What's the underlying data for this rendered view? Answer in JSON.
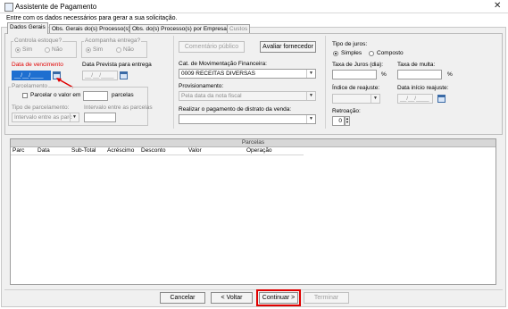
{
  "window": {
    "title": "Assistente de Pagamento",
    "close_glyph": "✕",
    "instruction": "Entre com os dados necessários para gerar a sua solicitação."
  },
  "tabs": [
    {
      "label": "Dados Gerais",
      "active": true,
      "enabled": true
    },
    {
      "label": "Obs. Gerais do(s) Processo(s)",
      "active": false,
      "enabled": true
    },
    {
      "label": "Obs. do(s) Processo(s) por Empresa(s)",
      "active": false,
      "enabled": true
    },
    {
      "label": "Custos",
      "active": false,
      "enabled": false
    }
  ],
  "left": {
    "controla_estoque": {
      "label": "Controla estoque?",
      "sim": "Sim",
      "nao": "Não",
      "selected": "Sim"
    },
    "acompanha_entrega": {
      "label": "Acompanha entrega?",
      "sim": "Sim",
      "nao": "Não",
      "selected": "Sim"
    },
    "data_vencimento": {
      "label": "Data de vencimento",
      "value": "__/__/____"
    },
    "data_prevista": {
      "label": "Data Prevista para entrega",
      "value": "__/__/____"
    },
    "parcelamento": {
      "label": "Parcelamento",
      "parcelar_label": "Parcelar o valor em",
      "parcelas_value": "",
      "parcelas_suffix": "parcelas",
      "tipo_label": "Tipo de parcelamento:",
      "tipo_value": "Intervalo entre as parc",
      "intervalo_label": "Intervalo entre as parcelas",
      "intervalo_value": ""
    }
  },
  "middle": {
    "comentario_button": "Comentário público",
    "avaliar_button": "Avaliar fornecedor",
    "cat_label": "Cat. de Movimentação Financeira:",
    "cat_value": "0009 RECEITAS DIVERSAS",
    "prov_label": "Provisionamento:",
    "prov_value": "Pela data da nota fiscal",
    "realizar_label": "Realizar o pagamento de distrato da venda:",
    "realizar_value": ""
  },
  "right": {
    "tipo_juros": {
      "label": "Tipo de juros:",
      "simples": "Simples",
      "composto": "Composto",
      "selected": "Simples"
    },
    "taxa_juros_label": "Taxa de Juros (dia):",
    "taxa_juros_value": "",
    "taxa_multa_label": "Taxa de multa:",
    "taxa_multa_value": "",
    "percent": "%",
    "indice_label": "Índice de reajuste:",
    "indice_value": "",
    "data_inicio_label": "Data início reajuste:",
    "data_inicio_value": "__/__/____",
    "retroacao_label": "Retroação:",
    "retroacao_value": "0"
  },
  "grid": {
    "title": "Parcelas",
    "columns": [
      "Parc",
      "Data",
      "Sub-Total",
      "Acréscimo",
      "Desconto",
      "Valor",
      "Operação"
    ]
  },
  "footer": {
    "cancelar": "Cancelar",
    "voltar": "< Voltar",
    "continuar": "Continuar >",
    "terminar": "Terminar"
  },
  "colors": {
    "highlight": "#e00000",
    "required_label": "#e00000",
    "focus_field": "#1e6fd0"
  }
}
